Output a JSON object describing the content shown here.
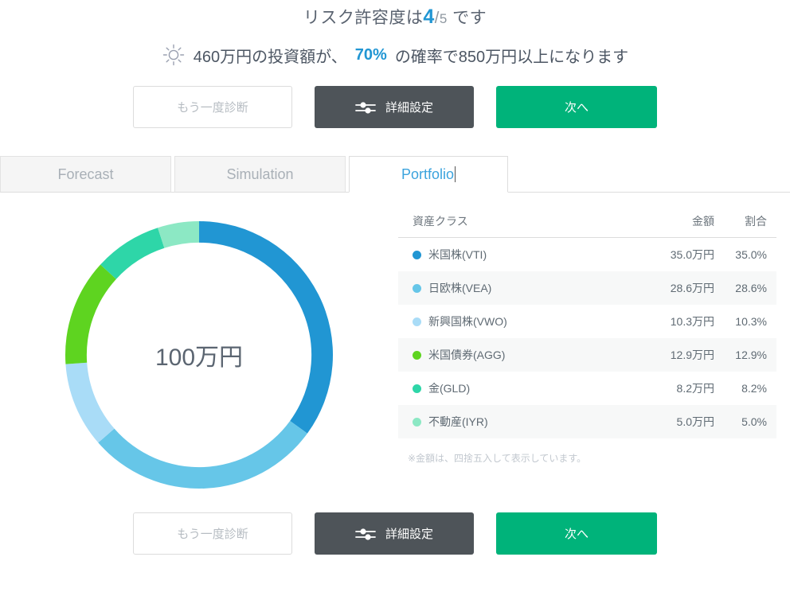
{
  "header": {
    "risk_prefix": "リスク許容度は",
    "risk_value": "4",
    "risk_slash": "/",
    "risk_max": "5",
    "risk_suffix": "です"
  },
  "subline": {
    "icon": "sun-icon",
    "part1": "460万円の投資額が、",
    "probability": "70%",
    "part2": "の確率で850万円以上になります"
  },
  "buttons": {
    "retry_label": "もう一度診断",
    "settings_label": "詳細設定",
    "settings_icon": "sliders-icon",
    "next_label": "次へ",
    "colors": {
      "dark": "#4e5459",
      "green": "#00b37a",
      "ghost_text": "#b6bcc2"
    }
  },
  "tabs": {
    "items": [
      {
        "label": "Forecast",
        "active": false
      },
      {
        "label": "Simulation",
        "active": false
      },
      {
        "label": "Portfolio",
        "active": true
      }
    ],
    "active_color": "#3ba3dd"
  },
  "donut": {
    "center_label": "100万円"
  },
  "table": {
    "headers": {
      "asset_class": "資産クラス",
      "amount": "金額",
      "ratio": "割合"
    },
    "rows": [
      {
        "name": "米国株(VTI)",
        "amount": "35.0万円",
        "ratio": "35.0%",
        "color": "#2196d3"
      },
      {
        "name": "日欧株(VEA)",
        "amount": "28.6万円",
        "ratio": "28.6%",
        "color": "#66c6e8"
      },
      {
        "name": "新興国株(VWO)",
        "amount": "10.3万円",
        "ratio": "10.3%",
        "color": "#a9dcf7"
      },
      {
        "name": "米国債券(AGG)",
        "amount": "12.9万円",
        "ratio": "12.9%",
        "color": "#5ed420"
      },
      {
        "name": "金(GLD)",
        "amount": "8.2万円",
        "ratio": "8.2%",
        "color": "#2ed6a8"
      },
      {
        "name": "不動産(IYR)",
        "amount": "5.0万円",
        "ratio": "5.0%",
        "color": "#8ce8c4"
      }
    ],
    "note": "※金額は、四捨五入して表示しています。"
  },
  "chart_data": {
    "type": "pie",
    "title": "Portfolio",
    "center_label": "100万円",
    "categories": [
      "米国株(VTI)",
      "日欧株(VEA)",
      "新興国株(VWO)",
      "米国債券(AGG)",
      "金(GLD)",
      "不動産(IYR)"
    ],
    "values": [
      35.0,
      28.6,
      10.3,
      12.9,
      8.2,
      5.0
    ],
    "amounts": [
      "35.0万円",
      "28.6万円",
      "10.3万円",
      "12.9万円",
      "8.2万円",
      "5.0万円"
    ],
    "unit": "%",
    "colors": [
      "#2196d3",
      "#66c6e8",
      "#a9dcf7",
      "#5ed420",
      "#2ed6a8",
      "#8ce8c4"
    ],
    "start_angle": 0,
    "direction": "clockwise",
    "inner_radius_ratio": 0.84,
    "legend": "right-table",
    "grid": false
  }
}
